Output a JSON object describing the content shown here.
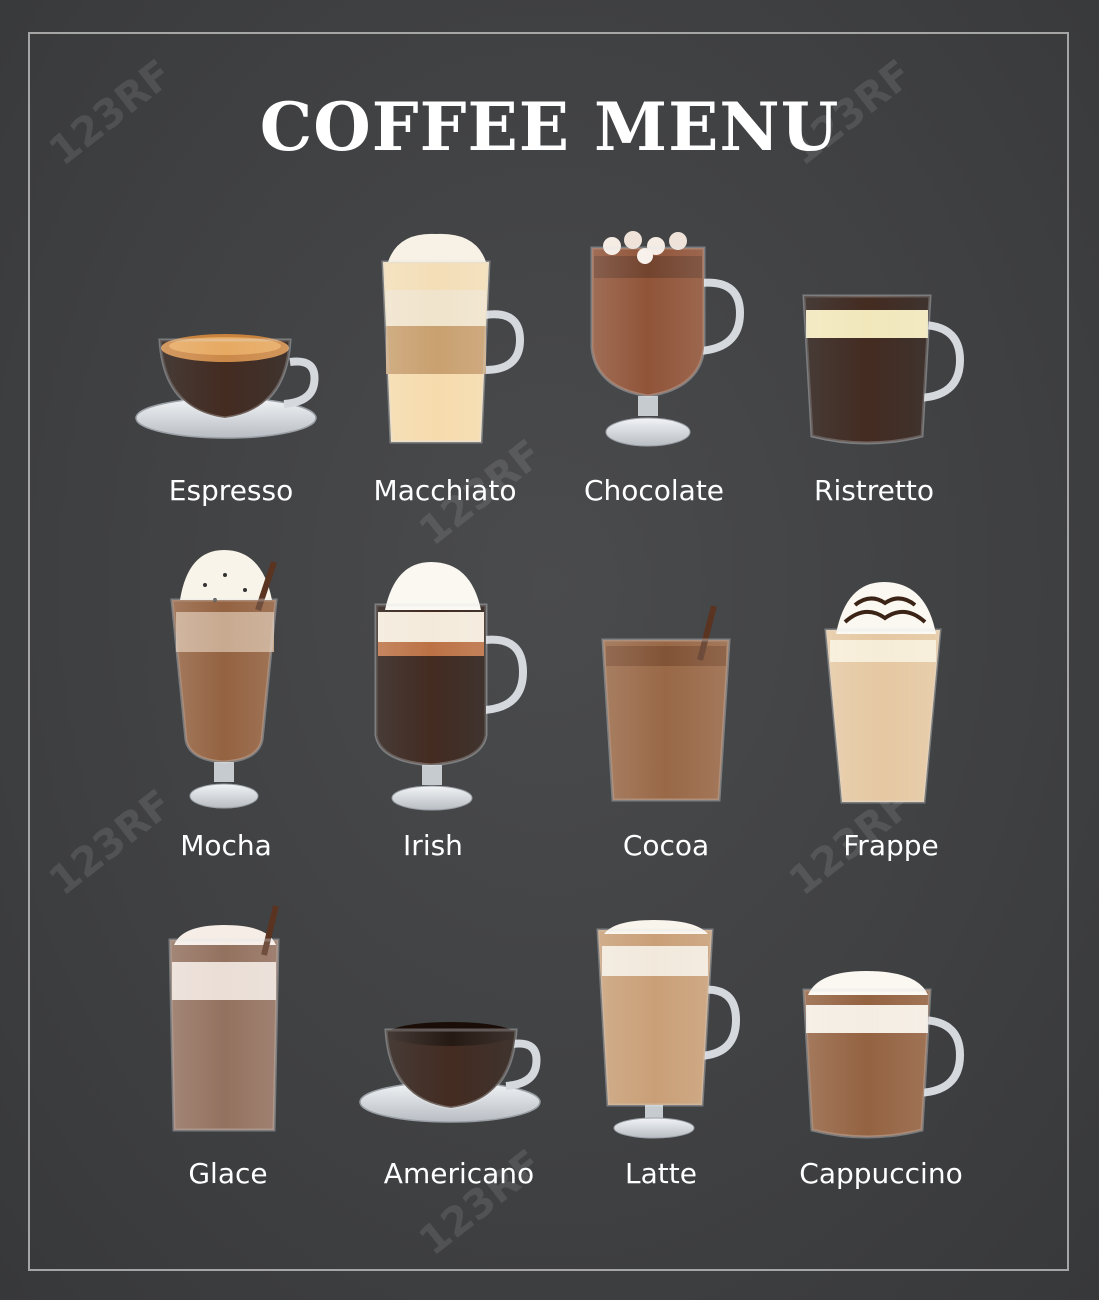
{
  "title": "COFFEE MENU",
  "watermark": "123RF",
  "items": [
    {
      "name": "Espresso"
    },
    {
      "name": "Macchiato"
    },
    {
      "name": "Chocolate"
    },
    {
      "name": "Ristretto"
    },
    {
      "name": "Mocha"
    },
    {
      "name": "Irish"
    },
    {
      "name": "Cocoa"
    },
    {
      "name": "Frappe"
    },
    {
      "name": "Glace"
    },
    {
      "name": "Americano"
    },
    {
      "name": "Latte"
    },
    {
      "name": "Cappuccino"
    }
  ],
  "colors": {
    "board": "#414244",
    "frame": "#b9b9b9",
    "text": "#ffffff",
    "glass": "#d9dde2",
    "coffee_dark": "#2a1710",
    "coffee_mid": "#7a4a30",
    "milk": "#f3e3c4",
    "cream": "#fbf7ee"
  }
}
